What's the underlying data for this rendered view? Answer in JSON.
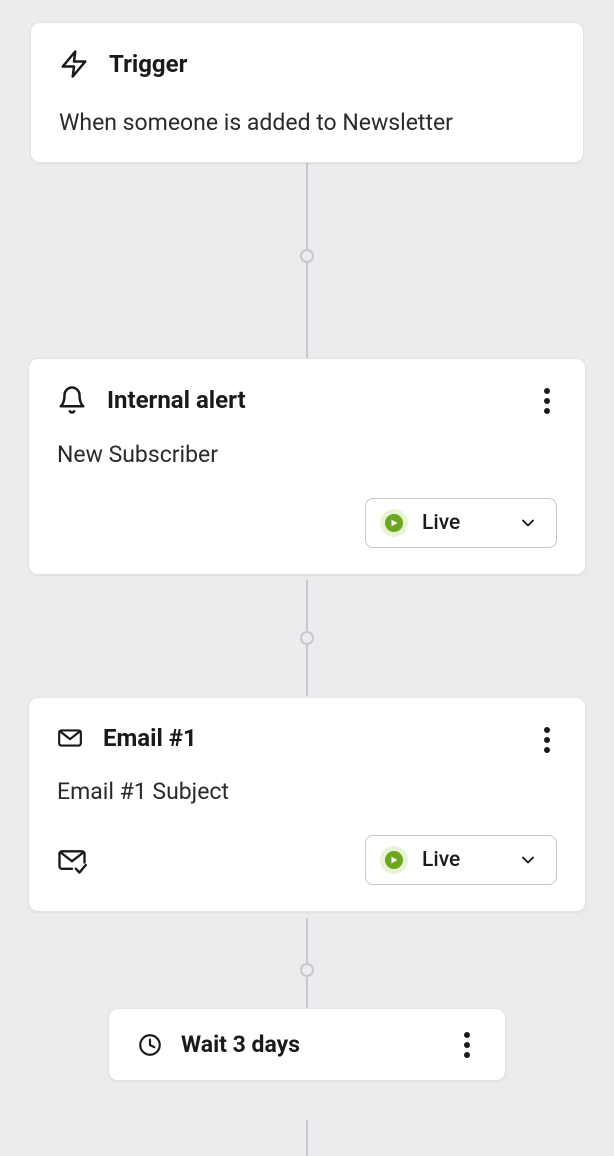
{
  "trigger": {
    "title": "Trigger",
    "subtitle": "When someone is added to Newsletter"
  },
  "alert": {
    "title": "Internal alert",
    "subtitle": "New Subscriber",
    "status_label": "Live"
  },
  "email": {
    "title": "Email #1",
    "subtitle": "Email #1 Subject",
    "status_label": "Live"
  },
  "wait": {
    "title": "Wait 3 days"
  }
}
